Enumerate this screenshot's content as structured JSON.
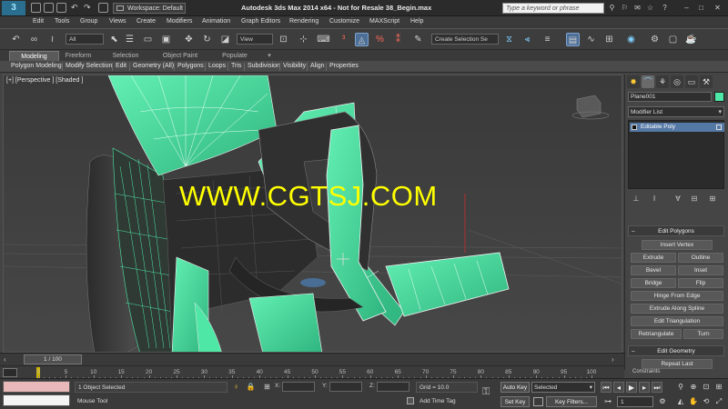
{
  "titlebar": {
    "app_logo": "3",
    "workspace": "Workspace: Default",
    "title": "Autodesk 3ds Max  2014 x64   - Not for Resale     38_Begin.max",
    "search_placeholder": "Type a keyword or phrase"
  },
  "menu": [
    "Edit",
    "Tools",
    "Group",
    "Views",
    "Create",
    "Modifiers",
    "Animation",
    "Graph Editors",
    "Rendering",
    "Customize",
    "MAXScript",
    "Help"
  ],
  "toolbar": {
    "selection_filter": "All",
    "reference_coord": "View",
    "selection_set": "Create Selection Se"
  },
  "ribbon": {
    "tabs": [
      "Modeling",
      "Freeform",
      "Selection",
      "Object Paint",
      "Populate"
    ],
    "active_tab": "Modeling",
    "panel_items": [
      "Polygon Modeling",
      "Modify Selection",
      "Edit",
      "Geometry (All)",
      "Polygons",
      "Loops",
      "Tris",
      "Subdivision",
      "Visibility",
      "Align",
      "Properties"
    ]
  },
  "viewport": {
    "label": "[+] [Perspective ] [Shaded ]",
    "watermark": "WWW.CGTSJ.COM"
  },
  "command_panel": {
    "object_name": "Plane001",
    "object_color": "#4fe7a6",
    "modifier_list": "Modifier List",
    "stack_item": "Editable Poly",
    "edit_polygons": {
      "title": "Edit Polygons",
      "insert_vertex": "Insert Vertex",
      "extrude": "Extrude",
      "outline": "Outline",
      "bevel": "Bevel",
      "inset": "Inset",
      "bridge": "Bridge",
      "flip": "Flip",
      "hinge": "Hinge From Edge",
      "extrude_spline": "Extrude Along Spline",
      "edit_triangulation": "Edit Triangulation",
      "retriangulate": "Retriangulate",
      "turn": "Turn"
    },
    "edit_geometry": {
      "title": "Edit Geometry",
      "repeat_last": "Repeat Last",
      "constraints": "Constraints"
    }
  },
  "timeslider": {
    "label": "1 / 100",
    "current_frame": 1,
    "total_frames": 100
  },
  "trackbar": {
    "ticks": [
      "0",
      "5",
      "10",
      "15",
      "20",
      "25",
      "30",
      "35",
      "40",
      "45",
      "50",
      "55",
      "60",
      "65",
      "70",
      "75",
      "80",
      "85",
      "90",
      "95",
      "100"
    ]
  },
  "status": {
    "selected": "1 Object Selected",
    "prompt": "Mouse Tool",
    "x_label": "X:",
    "y_label": "Y:",
    "z_label": "Z:",
    "grid": "Grid = 10.0",
    "add_time_tag": "Add Time Tag",
    "auto_key": "Auto Key",
    "set_key": "Set Key",
    "selected_dd": "Selected",
    "key_filters": "Key Filters...",
    "frame": "1"
  },
  "colors": {
    "mesh_green": "#4fe7a6",
    "mesh_dark": "#3a3a3a",
    "watermark": "#ffff00",
    "accent_blue": "#5579a5"
  }
}
